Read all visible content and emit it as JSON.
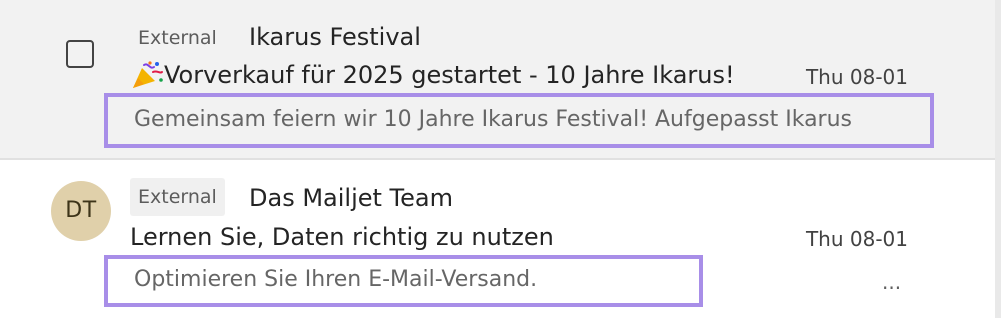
{
  "emails": [
    {
      "tag": "External",
      "sender": "Ikarus Festival",
      "subject": "Vorverkauf für 2025 gestartet - 10 Jahre Ikarus!",
      "subject_icon": "party-popper-icon",
      "date": "Thu 08-01",
      "preview": "Gemeinsam feiern wir 10 Jahre Ikarus Festival! Aufgepasst Ikarus",
      "selected": false,
      "row_background": "#f2f2f2"
    },
    {
      "tag": "External",
      "sender": "Das Mailjet Team",
      "avatar_initials": "DT",
      "avatar_color": "#e0d0aa",
      "subject": "Lernen Sie, Daten richtig zu nutzen",
      "date": "Thu 08-01",
      "preview": "Optimieren Sie Ihren E-Mail-Versand.",
      "more_indicator": "...",
      "row_background": "#ffffff"
    }
  ],
  "highlight_color": "#a88ee8"
}
